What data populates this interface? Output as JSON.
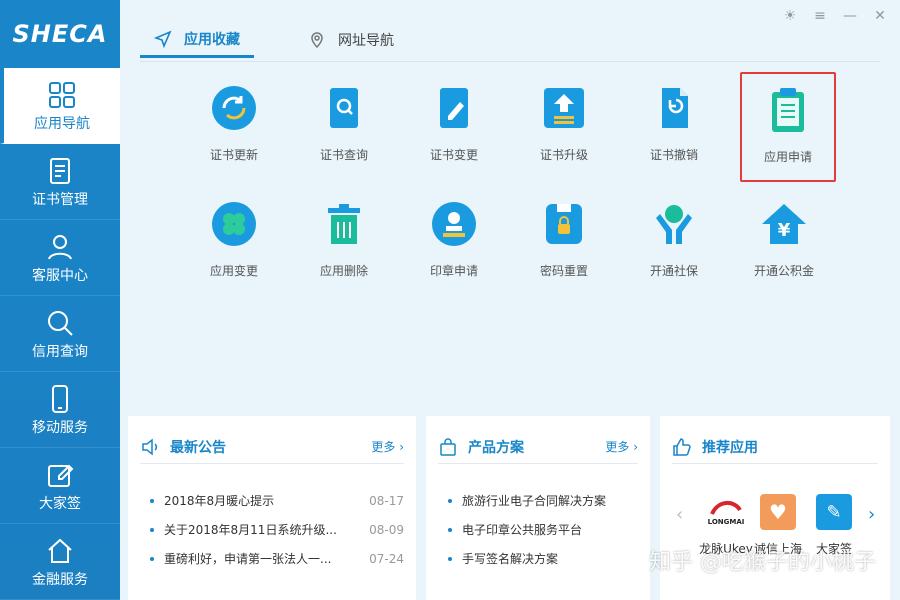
{
  "logo": "SHECA",
  "sidebar": {
    "items": [
      {
        "label": "应用导航",
        "icon": "grid-icon"
      },
      {
        "label": "证书管理",
        "icon": "document-icon"
      },
      {
        "label": "客服中心",
        "icon": "user-icon"
      },
      {
        "label": "信用查询",
        "icon": "search-icon"
      },
      {
        "label": "移动服务",
        "icon": "phone-icon"
      },
      {
        "label": "大家签",
        "icon": "edit-icon"
      },
      {
        "label": "金融服务",
        "icon": "home-icon"
      }
    ]
  },
  "tabs": [
    {
      "label": "应用收藏",
      "icon": "send-icon"
    },
    {
      "label": "网址导航",
      "icon": "location-icon"
    }
  ],
  "apps": [
    {
      "label": "证书更新",
      "icon": "refresh-icon"
    },
    {
      "label": "证书查询",
      "icon": "book-search-icon"
    },
    {
      "label": "证书变更",
      "icon": "book-edit-icon"
    },
    {
      "label": "证书升级",
      "icon": "upgrade-icon"
    },
    {
      "label": "证书撤销",
      "icon": "revoke-icon"
    },
    {
      "label": "应用申请",
      "icon": "clipboard-icon"
    },
    {
      "label": "应用变更",
      "icon": "clover-icon"
    },
    {
      "label": "应用删除",
      "icon": "trash-icon"
    },
    {
      "label": "印章申请",
      "icon": "seal-icon"
    },
    {
      "label": "密码重置",
      "icon": "usb-lock-icon"
    },
    {
      "label": "开通社保",
      "icon": "hands-globe-icon"
    },
    {
      "label": "开通公积金",
      "icon": "house-yen-icon"
    }
  ],
  "announcements": {
    "title": "最新公告",
    "more": "更多",
    "items": [
      {
        "text": "2018年8月暖心提示",
        "date": "08-17"
      },
      {
        "text": "关于2018年8月11日系统升级...",
        "date": "08-09"
      },
      {
        "text": "重磅利好，申请第一张法人一...",
        "date": "07-24"
      }
    ]
  },
  "solutions": {
    "title": "产品方案",
    "more": "更多",
    "items": [
      {
        "text": "旅游行业电子合同解决方案"
      },
      {
        "text": "电子印章公共服务平台"
      },
      {
        "text": "手写签名解决方案"
      }
    ]
  },
  "recommended": {
    "title": "推荐应用",
    "apps": [
      {
        "label": "龙脉Ukey",
        "brand": "LONGMAI"
      },
      {
        "label": "诚信上海"
      },
      {
        "label": "大家签"
      }
    ]
  },
  "watermark": "知乎 @吃猴子的小桃子",
  "colors": {
    "accent": "#1a86c9",
    "highlight": "#e23b3b"
  }
}
